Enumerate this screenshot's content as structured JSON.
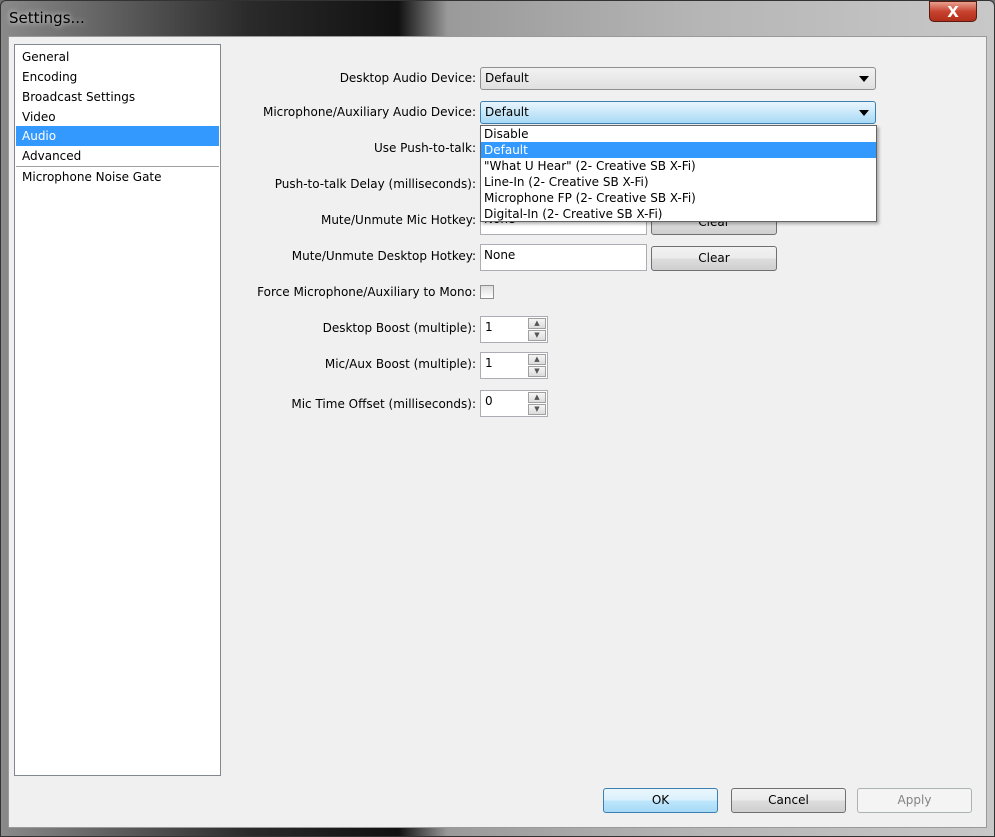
{
  "window": {
    "title": "Settings...",
    "close_label": "X"
  },
  "sidebar": {
    "items": [
      {
        "label": "General"
      },
      {
        "label": "Encoding"
      },
      {
        "label": "Broadcast Settings"
      },
      {
        "label": "Video"
      },
      {
        "label": "Audio",
        "selected": true
      },
      {
        "label": "Advanced"
      },
      {
        "label": "Microphone Noise Gate"
      }
    ]
  },
  "audio": {
    "desktop_device": {
      "label": "Desktop Audio Device:",
      "value": "Default"
    },
    "mic_device": {
      "label": "Microphone/Auxiliary Audio Device:",
      "value": "Default",
      "options": [
        "Disable",
        "Default",
        "\"What U Hear\" (2- Creative SB X-Fi)",
        "Line-In (2- Creative SB X-Fi)",
        "Microphone FP (2- Creative SB X-Fi)",
        "Digital-In (2- Creative SB X-Fi)"
      ]
    },
    "push_to_talk": {
      "label": "Use Push-to-talk:"
    },
    "ptt_delay": {
      "label": "Push-to-talk Delay (milliseconds):"
    },
    "mute_mic_hotkey": {
      "label": "Mute/Unmute Mic Hotkey:",
      "value": "None",
      "clear": "Clear"
    },
    "mute_desktop_hotkey": {
      "label": "Mute/Unmute Desktop Hotkey:",
      "value": "None",
      "clear": "Clear"
    },
    "force_mono": {
      "label": "Force Microphone/Auxiliary to Mono:",
      "checked": false
    },
    "desktop_boost": {
      "label": "Desktop Boost (multiple):",
      "value": "1"
    },
    "mic_boost": {
      "label": "Mic/Aux Boost (multiple):",
      "value": "1"
    },
    "mic_offset": {
      "label": "Mic Time Offset (milliseconds):",
      "value": "0"
    }
  },
  "buttons": {
    "ok": "OK",
    "cancel": "Cancel",
    "apply": "Apply"
  }
}
